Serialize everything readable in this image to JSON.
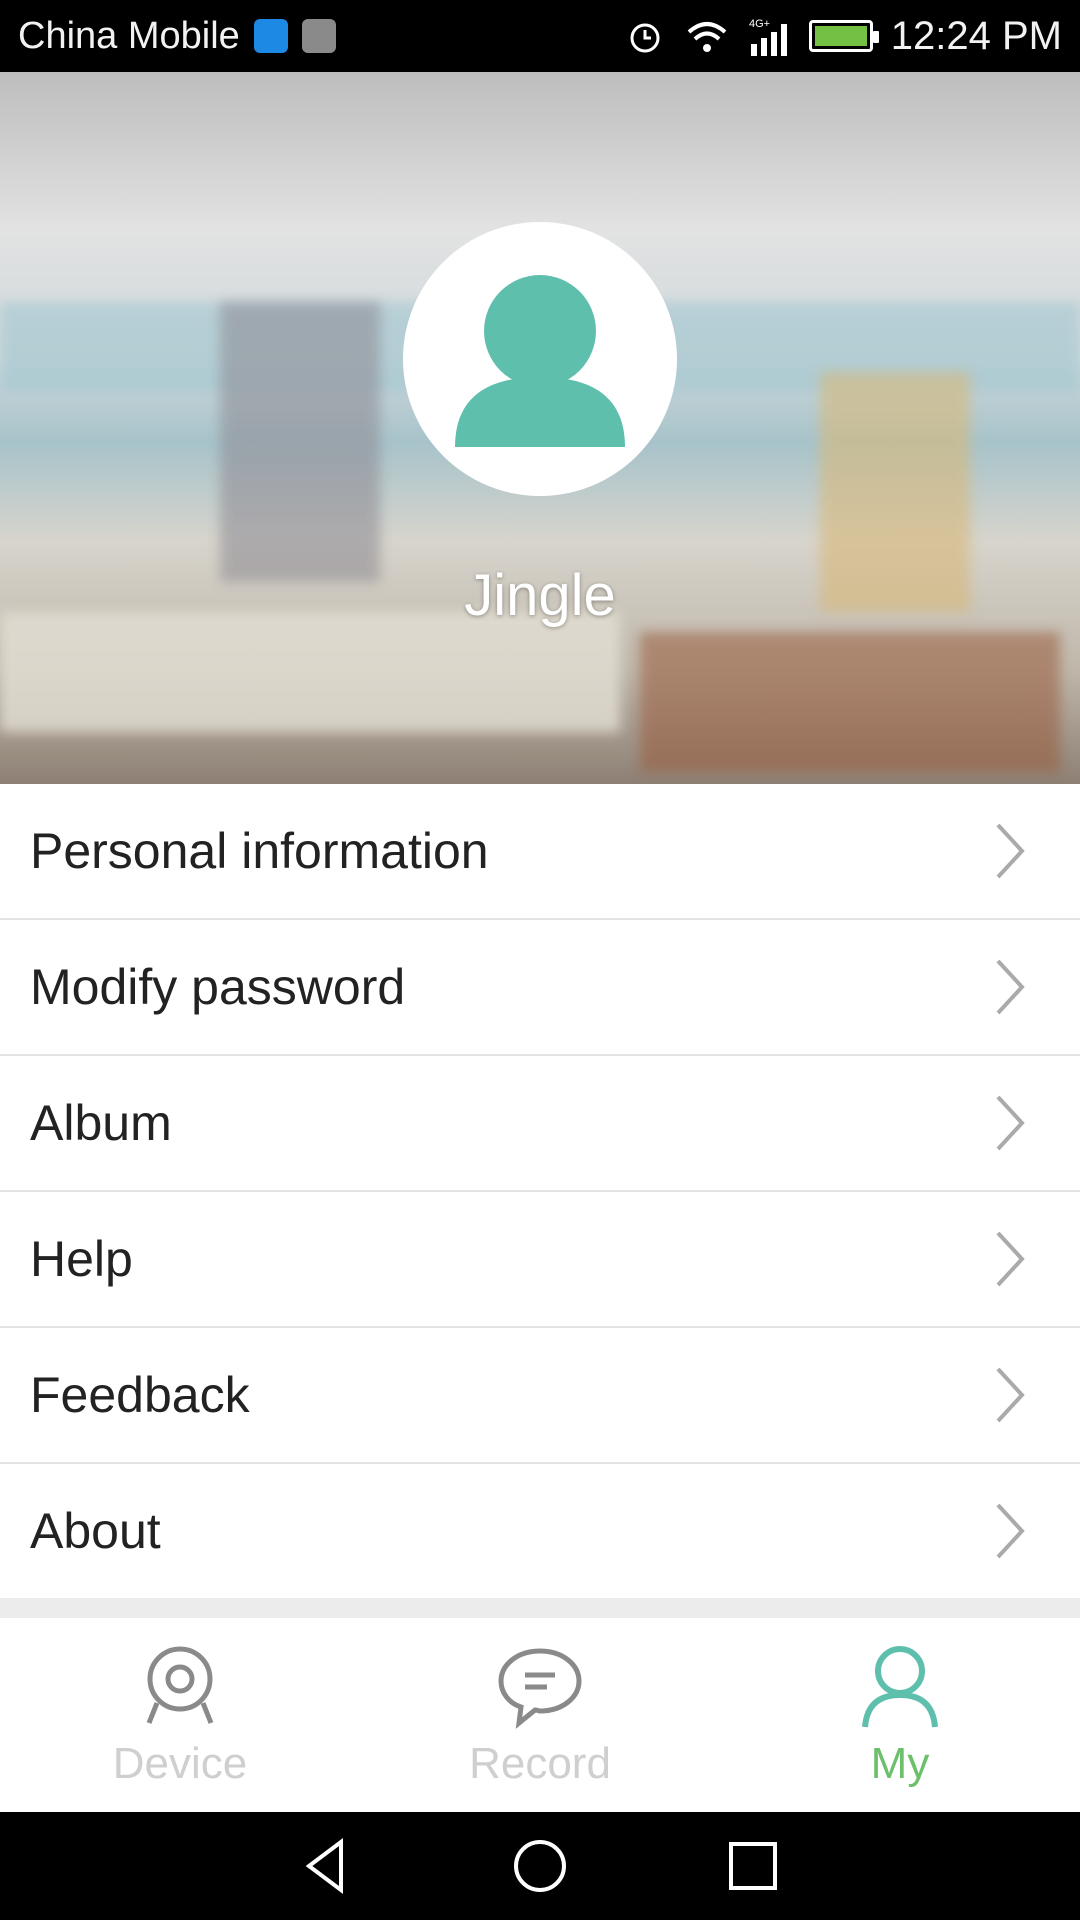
{
  "status_bar": {
    "carrier": "China Mobile",
    "time": "12:24 PM",
    "network": "4G+",
    "icons": [
      "usb-icon",
      "image-icon",
      "alarm-icon",
      "wifi-icon",
      "signal-icon",
      "battery-icon"
    ]
  },
  "profile": {
    "username": "Jingle",
    "avatar_icon": "person-icon",
    "avatar_color": "#5fbfad"
  },
  "menu": {
    "items": [
      {
        "label": "Personal information"
      },
      {
        "label": "Modify password"
      },
      {
        "label": "Album"
      },
      {
        "label": "Help"
      },
      {
        "label": "Feedback"
      },
      {
        "label": "About"
      }
    ]
  },
  "tabs": {
    "items": [
      {
        "label": "Device",
        "icon": "camera-icon",
        "active": false
      },
      {
        "label": "Record",
        "icon": "chat-bubble-icon",
        "active": false
      },
      {
        "label": "My",
        "icon": "person-icon",
        "active": true
      }
    ],
    "active_color": "#6cc06b",
    "inactive_color": "#cfcfcf"
  },
  "nav_bar": {
    "buttons": [
      "back-icon",
      "home-icon",
      "recents-icon"
    ]
  }
}
